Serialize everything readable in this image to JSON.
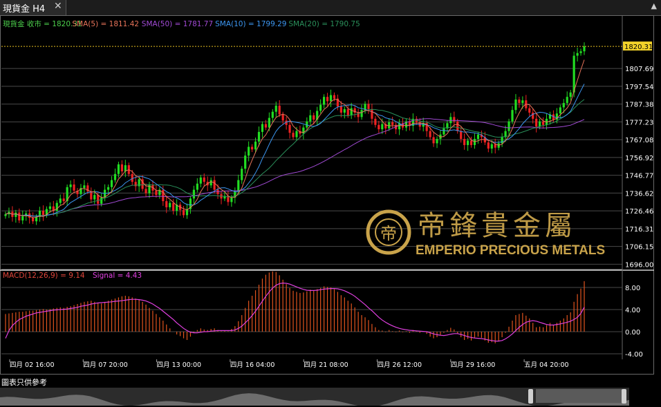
{
  "tab": {
    "title": "現貨金 H4",
    "close": "✕"
  },
  "collapse_icon": "▲",
  "footer": {
    "note": "圖表只供參考"
  },
  "watermark": {
    "logo": "帝鋒貴金屬",
    "text": "EMPERIO PRECIOUS METALS",
    "color": "#c9a34a"
  },
  "chart_data": [
    {
      "type": "candlestick",
      "legend": [
        {
          "label": "現貨金 收市 = 1820.31",
          "color": "#4ccf4c"
        },
        {
          "label": "SMA(5) = 1811.42",
          "color": "#e8745a"
        },
        {
          "label": "SMA(50) = 1781.77",
          "color": "#a24bd6"
        },
        {
          "label": "SMA(10) = 1799.29",
          "color": "#3c96f0"
        },
        {
          "label": "SMA(20) = 1790.75",
          "color": "#2a8f5a"
        }
      ],
      "ylim": [
        1693,
        1831
      ],
      "yticks": [
        "1807.69",
        "1797.54",
        "1787.38",
        "1777.23",
        "1767.08",
        "1756.92",
        "1746.77",
        "1736.62",
        "1726.46",
        "1716.31",
        "1706.15",
        "1696.00"
      ],
      "last_price": "1820.31",
      "xticks": [
        "四月 02 16:00",
        "四月 07 20:00",
        "四月 13 00:00",
        "四月 16 04:00",
        "四月 21 08:00",
        "四月 26 12:00",
        "四月 29 16:00",
        "五月 04 20:00"
      ],
      "close": [
        1724.5,
        1726.0,
        1723.0,
        1725.5,
        1721.0,
        1723.5,
        1725.0,
        1722.5,
        1720.5,
        1723.0,
        1726.5,
        1724.0,
        1727.5,
        1729.0,
        1726.5,
        1731.0,
        1733.5,
        1732.0,
        1740.0,
        1741.5,
        1738.0,
        1736.0,
        1739.5,
        1741.0,
        1737.5,
        1733.0,
        1735.5,
        1730.5,
        1734.0,
        1738.5,
        1740.0,
        1744.0,
        1747.5,
        1753.0,
        1749.0,
        1752.5,
        1747.5,
        1743.0,
        1740.5,
        1744.5,
        1739.0,
        1736.5,
        1741.5,
        1738.0,
        1735.5,
        1738.5,
        1732.0,
        1728.5,
        1731.0,
        1726.5,
        1730.0,
        1727.0,
        1724.0,
        1727.5,
        1733.5,
        1738.5,
        1742.0,
        1745.5,
        1743.0,
        1741.0,
        1744.0,
        1738.5,
        1736.0,
        1733.5,
        1735.0,
        1731.5,
        1734.0,
        1737.5,
        1744.0,
        1750.5,
        1758.0,
        1763.0,
        1761.5,
        1766.0,
        1771.5,
        1776.0,
        1774.0,
        1779.5,
        1783.0,
        1786.5,
        1781.5,
        1778.0,
        1775.5,
        1771.0,
        1768.5,
        1772.0,
        1770.5,
        1774.0,
        1777.5,
        1781.0,
        1778.5,
        1783.5,
        1787.0,
        1791.5,
        1789.0,
        1792.5,
        1790.5,
        1786.0,
        1782.5,
        1784.5,
        1781.0,
        1785.0,
        1782.5,
        1780.0,
        1784.0,
        1787.5,
        1784.5,
        1779.0,
        1775.5,
        1773.0,
        1776.0,
        1773.5,
        1777.0,
        1775.5,
        1773.0,
        1776.5,
        1774.0,
        1777.5,
        1775.0,
        1779.0,
        1777.0,
        1774.5,
        1776.5,
        1772.0,
        1768.5,
        1765.0,
        1767.5,
        1770.0,
        1773.5,
        1776.5,
        1780.0,
        1777.5,
        1772.0,
        1767.5,
        1764.0,
        1766.5,
        1764.0,
        1767.5,
        1770.0,
        1768.5,
        1765.5,
        1762.0,
        1764.5,
        1762.5,
        1765.0,
        1768.5,
        1772.0,
        1777.5,
        1784.0,
        1790.0,
        1788.0,
        1789.5,
        1785.0,
        1782.5,
        1779.0,
        1774.5,
        1777.5,
        1775.5,
        1779.0,
        1781.5,
        1778.5,
        1782.0,
        1785.5,
        1788.0,
        1791.5,
        1794.0,
        1815.0,
        1816.5,
        1817.5,
        1820.31
      ],
      "candle_count": 176
    },
    {
      "type": "macd",
      "legend": [
        {
          "label": "MACD(12,26,9) = 9.14",
          "color": "#e0453a"
        },
        {
          "label": "Signal = 4.43",
          "color": "#e040e0"
        }
      ],
      "ylim": [
        -5,
        11
      ],
      "yticks": [
        "8.00",
        "4.00",
        "0.00",
        "-4.00"
      ],
      "macd": [
        3.2,
        3.3,
        3.4,
        3.5,
        3.6,
        3.6,
        3.7,
        3.8,
        3.8,
        3.9,
        4.0,
        4.1,
        4.0,
        4.1,
        4.2,
        4.3,
        4.4,
        4.3,
        4.5,
        4.6,
        4.8,
        5.0,
        5.2,
        5.4,
        5.5,
        5.6,
        5.4,
        5.2,
        5.1,
        5.4,
        5.6,
        5.8,
        6.0,
        6.2,
        6.4,
        6.5,
        6.4,
        6.2,
        6.0,
        5.8,
        5.4,
        4.9,
        4.3,
        3.8,
        3.2,
        2.6,
        2.0,
        1.3,
        0.6,
        0.0,
        -0.5,
        -0.8,
        -1.2,
        -1.5,
        -0.9,
        -0.2,
        0.3,
        0.6,
        0.4,
        0.3,
        0.5,
        0.6,
        0.3,
        0.1,
        0.2,
        0.1,
        0.5,
        1.0,
        1.9,
        3.0,
        4.3,
        5.6,
        6.5,
        7.5,
        8.5,
        9.6,
        10.3,
        10.7,
        10.9,
        10.8,
        10.2,
        9.4,
        8.6,
        7.9,
        7.4,
        7.2,
        7.0,
        7.1,
        7.3,
        7.6,
        7.4,
        7.7,
        7.9,
        8.2,
        8.1,
        8.0,
        7.7,
        7.2,
        6.6,
        6.2,
        5.6,
        5.1,
        4.4,
        3.6,
        3.0,
        2.6,
        2.1,
        1.4,
        0.8,
        0.3,
        0.2,
        -0.1,
        0.3,
        0.1,
        -0.1,
        0.2,
        -0.1,
        0.1,
        -0.2,
        0.3,
        0.1,
        -0.2,
        0.0,
        -0.4,
        -0.9,
        -1.2,
        -1.0,
        -0.6,
        -0.2,
        0.3,
        0.7,
        0.4,
        -0.3,
        -1.0,
        -1.5,
        -1.3,
        -1.6,
        -1.2,
        -0.9,
        -1.1,
        -1.6,
        -2.0,
        -1.9,
        -2.1,
        -1.7,
        -1.0,
        -0.2,
        0.9,
        2.0,
        3.0,
        3.2,
        3.4,
        2.9,
        2.4,
        1.6,
        0.8,
        0.9,
        0.8,
        1.2,
        1.6,
        1.2,
        1.6,
        2.0,
        2.4,
        3.0,
        3.5,
        5.4,
        6.8,
        7.8,
        9.14
      ],
      "signal": [
        -1.2,
        0.2,
        1.1,
        1.7,
        2.2,
        2.5,
        2.8,
        3.0,
        3.2,
        3.4,
        3.5,
        3.6,
        3.7,
        3.8,
        3.9,
        3.95,
        4.0,
        4.05,
        4.1,
        4.2,
        4.3,
        4.4,
        4.6,
        4.7,
        4.8,
        5.0,
        5.1,
        5.2,
        5.25,
        5.3,
        5.35,
        5.4,
        5.5,
        5.55,
        5.6,
        5.7,
        5.8,
        5.85,
        5.85,
        5.8,
        5.7,
        5.55,
        5.3,
        5.0,
        4.6,
        4.2,
        3.7,
        3.2,
        2.7,
        2.2,
        1.6,
        1.1,
        0.6,
        0.2,
        -0.1,
        -0.2,
        -0.2,
        -0.1,
        0.0,
        0.0,
        0.1,
        0.15,
        0.2,
        0.2,
        0.2,
        0.2,
        0.2,
        0.3,
        0.6,
        1.0,
        1.6,
        2.2,
        2.9,
        3.7,
        4.6,
        5.5,
        6.4,
        7.2,
        7.9,
        8.4,
        8.7,
        8.8,
        8.75,
        8.6,
        8.35,
        8.1,
        7.85,
        7.65,
        7.5,
        7.45,
        7.45,
        7.5,
        7.6,
        7.7,
        7.75,
        7.8,
        7.8,
        7.75,
        7.6,
        7.4,
        7.1,
        6.8,
        6.4,
        5.9,
        5.4,
        4.9,
        4.3,
        3.8,
        3.2,
        2.6,
        2.1,
        1.7,
        1.35,
        1.05,
        0.8,
        0.6,
        0.45,
        0.35,
        0.25,
        0.2,
        0.15,
        0.1,
        0.05,
        0.0,
        -0.2,
        -0.4,
        -0.55,
        -0.65,
        -0.7,
        -0.6,
        -0.45,
        -0.35,
        -0.35,
        -0.5,
        -0.7,
        -0.9,
        -1.05,
        -1.15,
        -1.2,
        -1.25,
        -1.35,
        -1.5,
        -1.6,
        -1.7,
        -1.7,
        -1.6,
        -1.3,
        -0.9,
        -0.4,
        0.2,
        0.8,
        1.3,
        1.7,
        1.9,
        2.0,
        1.9,
        1.7,
        1.5,
        1.3,
        1.2,
        1.2,
        1.3,
        1.4,
        1.55,
        1.7,
        1.9,
        2.2,
        2.6,
        3.3,
        4.43
      ]
    }
  ]
}
